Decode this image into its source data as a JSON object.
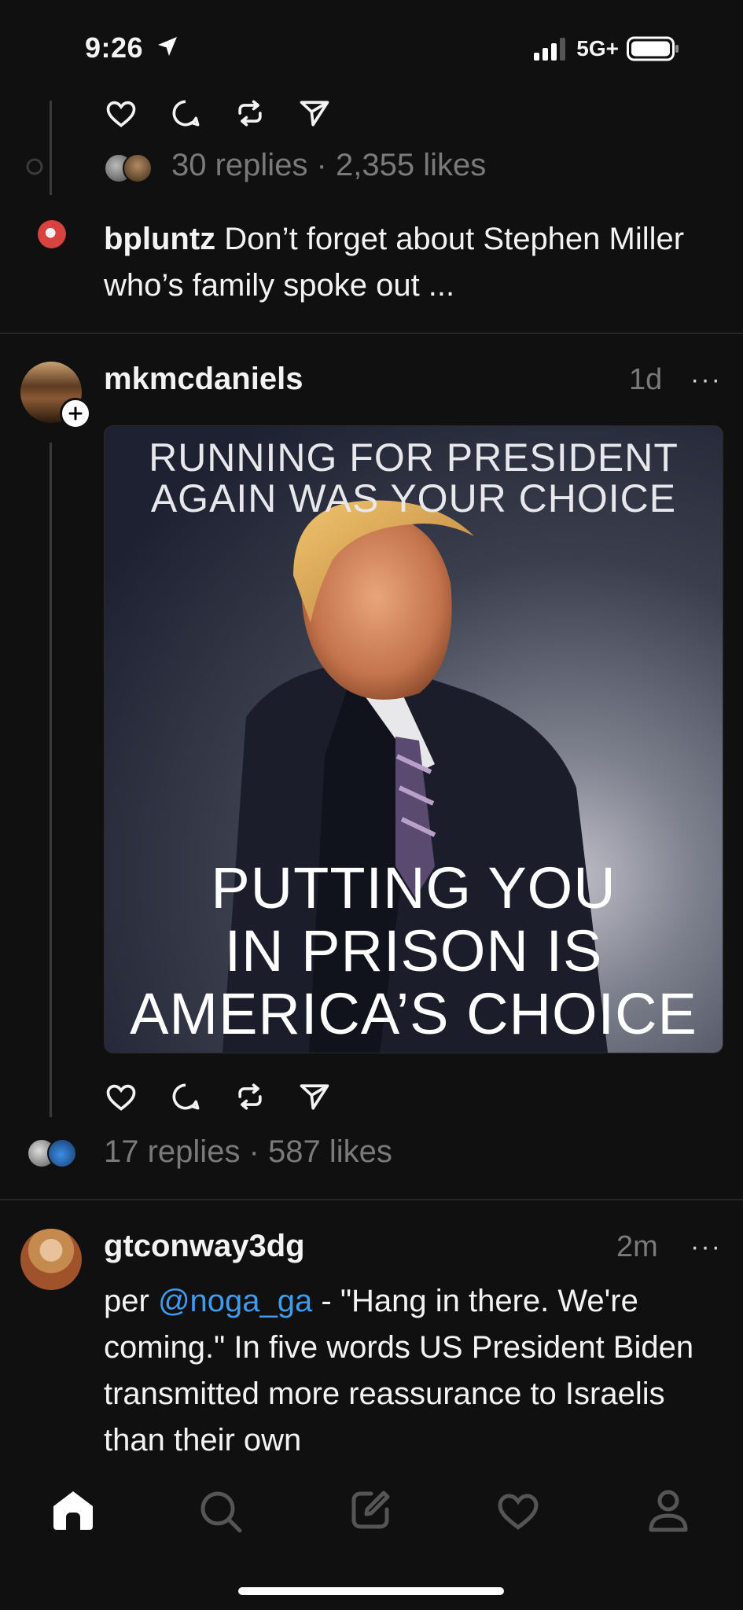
{
  "status_bar": {
    "time": "9:26",
    "network": "5G+"
  },
  "previous_post": {
    "meta": "30 replies · 2,355 likes",
    "reply_preview": {
      "username": "bpluntz",
      "text": "Don’t forget about Stephen Miller  who’s family spoke out ..."
    }
  },
  "post1": {
    "username": "mkmcdaniels",
    "time": "1d",
    "more": "···",
    "image": {
      "caption_top_line1": "RUNNING FOR PRESIDENT",
      "caption_top_line2": "AGAIN WAS YOUR CHOICE",
      "caption_bottom_line1": "PUTTING YOU",
      "caption_bottom_line2": "IN PRISON IS",
      "caption_bottom_line3": "AMERICA’S CHOICE"
    },
    "meta": "17 replies · 587 likes"
  },
  "post2": {
    "username": "gtconway3dg",
    "time": "2m",
    "more": "···",
    "text_before": "per ",
    "mention": "@noga_ga",
    "text_after": " - \"Hang in there. We're coming.\" In five words US President Biden transmitted more reassurance to Israelis than their own"
  },
  "nav": {
    "items": [
      {
        "icon": "home-icon",
        "active": true
      },
      {
        "icon": "search-icon",
        "active": false
      },
      {
        "icon": "compose-icon",
        "active": false
      },
      {
        "icon": "activity-heart-icon",
        "active": false
      },
      {
        "icon": "profile-icon",
        "active": false
      }
    ]
  },
  "colors": {
    "background": "#101010",
    "muted": "#7a7a7a",
    "link": "#3b9cf0"
  }
}
